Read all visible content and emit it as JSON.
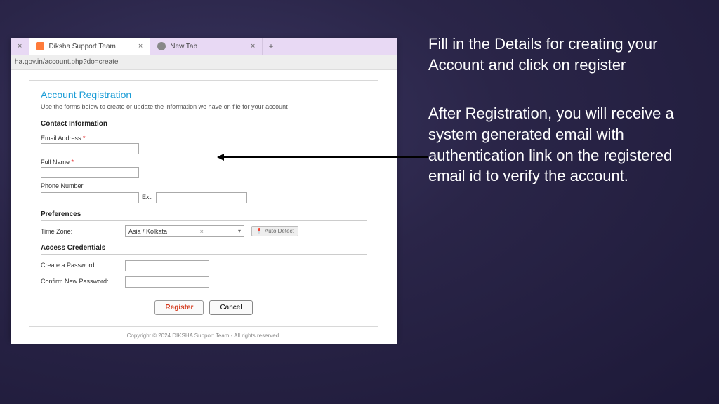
{
  "browser": {
    "tabs": [
      {
        "title": "Diksha Support Team"
      },
      {
        "title": "New Tab"
      }
    ],
    "url": "ha.gov.in/account.php?do=create"
  },
  "page": {
    "title": "Account Registration",
    "subtitle": "Use the forms below to create or update the information we have on file for your account",
    "sections": {
      "contact": {
        "heading": "Contact Information",
        "email_label": "Email Address",
        "fullname_label": "Full Name",
        "phone_label": "Phone Number",
        "ext_label": "Ext:"
      },
      "preferences": {
        "heading": "Preferences",
        "timezone_label": "Time Zone:",
        "timezone_value": "Asia / Kolkata",
        "auto_detect": "Auto Detect"
      },
      "credentials": {
        "heading": "Access Credentials",
        "create_pw": "Create a Password:",
        "confirm_pw": "Confirm New Password:"
      }
    },
    "buttons": {
      "register": "Register",
      "cancel": "Cancel"
    },
    "footer": "Copyright © 2024 DIKSHA Support Team - All rights reserved."
  },
  "slide": {
    "para1": "Fill in the Details for creating your Account and click on register",
    "para2": "After Registration, you will receive a system generated email with authentication link on the registered email id to verify the account."
  }
}
